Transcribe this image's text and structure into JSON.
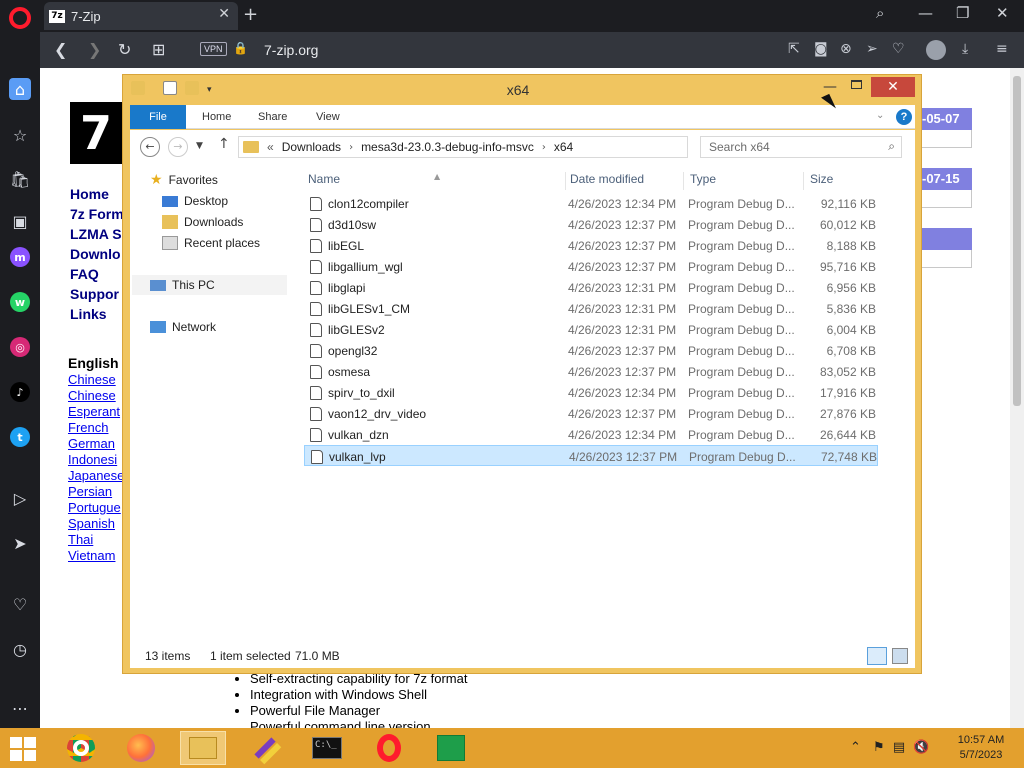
{
  "browser": {
    "tab_title": "7-Zip",
    "tab_favicon": "7z",
    "url": "7-zip.org",
    "vpn_label": "VPN",
    "accent_color": "#ff1b2d"
  },
  "site": {
    "logo": "7",
    "nav": [
      "Home",
      "7z Form",
      "LZMA S",
      "Downlo",
      "FAQ",
      "Suppor",
      "Links"
    ],
    "lang_heading": "English",
    "langs": [
      "Chinese",
      "Chinese",
      "Esperant",
      "French",
      "German",
      "Indonesi",
      "Japanese",
      "Persian",
      "Portugue",
      "Spanish",
      "Thai",
      "Vietnam"
    ],
    "dates": [
      "-05-07",
      "-07-15"
    ],
    "features": [
      "Self-extracting capability for 7z format",
      "Integration with Windows Shell",
      "Powerful File Manager",
      "Powerful command line version"
    ]
  },
  "explorer": {
    "title": "x64",
    "ribbon_tabs": [
      "File",
      "Home",
      "Share",
      "View"
    ],
    "breadcrumb_prefix": "«",
    "breadcrumb": [
      "Downloads",
      "mesa3d-23.0.3-debug-info-msvc",
      "x64"
    ],
    "search_placeholder": "Search x64",
    "nav_pane": {
      "favorites": "Favorites",
      "favorites_items": [
        "Desktop",
        "Downloads",
        "Recent places"
      ],
      "this_pc": "This PC",
      "network": "Network"
    },
    "columns": [
      "Name",
      "Date modified",
      "Type",
      "Size"
    ],
    "files": [
      {
        "name": "clon12compiler",
        "date": "4/26/2023 12:34 PM",
        "type": "Program Debug D...",
        "size": "92,116 KB"
      },
      {
        "name": "d3d10sw",
        "date": "4/26/2023 12:37 PM",
        "type": "Program Debug D...",
        "size": "60,012 KB"
      },
      {
        "name": "libEGL",
        "date": "4/26/2023 12:37 PM",
        "type": "Program Debug D...",
        "size": "8,188 KB"
      },
      {
        "name": "libgallium_wgl",
        "date": "4/26/2023 12:37 PM",
        "type": "Program Debug D...",
        "size": "95,716 KB"
      },
      {
        "name": "libglapi",
        "date": "4/26/2023 12:31 PM",
        "type": "Program Debug D...",
        "size": "6,956 KB"
      },
      {
        "name": "libGLESv1_CM",
        "date": "4/26/2023 12:31 PM",
        "type": "Program Debug D...",
        "size": "5,836 KB"
      },
      {
        "name": "libGLESv2",
        "date": "4/26/2023 12:31 PM",
        "type": "Program Debug D...",
        "size": "6,004 KB"
      },
      {
        "name": "opengl32",
        "date": "4/26/2023 12:37 PM",
        "type": "Program Debug D...",
        "size": "6,708 KB"
      },
      {
        "name": "osmesa",
        "date": "4/26/2023 12:37 PM",
        "type": "Program Debug D...",
        "size": "83,052 KB"
      },
      {
        "name": "spirv_to_dxil",
        "date": "4/26/2023 12:34 PM",
        "type": "Program Debug D...",
        "size": "17,916 KB"
      },
      {
        "name": "vaon12_drv_video",
        "date": "4/26/2023 12:37 PM",
        "type": "Program Debug D...",
        "size": "27,876 KB"
      },
      {
        "name": "vulkan_dzn",
        "date": "4/26/2023 12:34 PM",
        "type": "Program Debug D...",
        "size": "26,644 KB"
      },
      {
        "name": "vulkan_lvp",
        "date": "4/26/2023 12:37 PM",
        "type": "Program Debug D...",
        "size": "72,748 KB"
      }
    ],
    "status": {
      "count": "13 items",
      "selected": "1 item selected",
      "size": "71.0 MB"
    },
    "selected_file": "vulkan_lvp",
    "frame_color": "#f0c560"
  },
  "taskbar": {
    "time": "10:57 AM",
    "date": "5/7/2023",
    "color": "#e3a02e",
    "apps": [
      "chrome-icon",
      "firefox-icon",
      "file-explorer-icon",
      "tool-icon",
      "cmd-icon",
      "opera-icon",
      "store-icon"
    ]
  }
}
